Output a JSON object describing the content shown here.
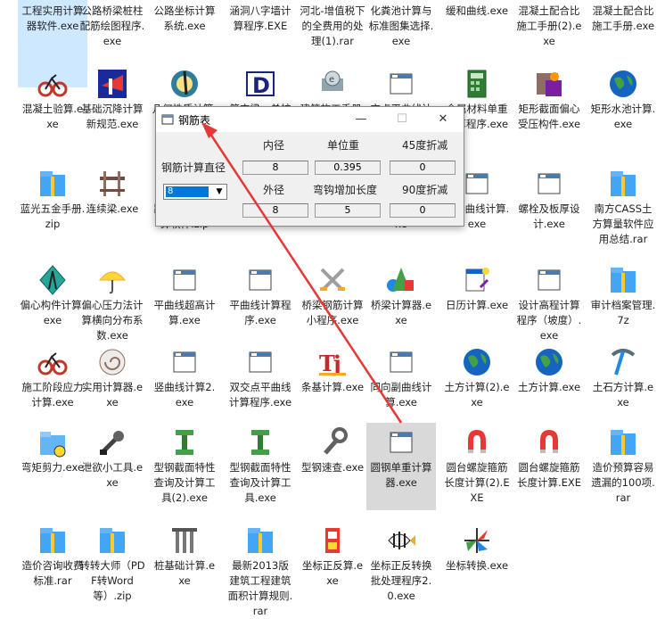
{
  "desktop": {
    "icons": [
      {
        "label": "工程实用计算器软件.exe",
        "art": "none"
      },
      {
        "label": "公路桥梁桩柱配筋绘图程序.exe",
        "art": "none"
      },
      {
        "label": "公路坐标计算系统.exe",
        "art": "none"
      },
      {
        "label": "涵洞八字墙计算程序.EXE",
        "art": "none"
      },
      {
        "label": "河北-增值税下的全费用的处理(1).rar",
        "art": "none"
      },
      {
        "label": "化粪池计算与标准图集选择.exe",
        "art": "none"
      },
      {
        "label": "缓和曲线.exe",
        "art": "none"
      },
      {
        "label": "混凝土配合比施工手册(2).exe",
        "art": "none"
      },
      {
        "label": "混凝土配合比施工手册.exe",
        "art": "none"
      },
      {
        "label": "混凝土验算.exe",
        "art": "bike"
      },
      {
        "label": "基础沉降计算新规范.exe",
        "art": "flag"
      },
      {
        "label": "几何性质计算.exe",
        "art": "compass"
      },
      {
        "label": "简支梁、单桩计算.exe",
        "art": "drafter"
      },
      {
        "label": "建筑施工手册.exe",
        "art": "printer"
      },
      {
        "label": "交点平曲线计算.exe",
        "art": "window"
      },
      {
        "label": "金属材料单重计算程序.exe",
        "art": "calc"
      },
      {
        "label": "矩形截面偏心受压构件.exe",
        "art": "installer"
      },
      {
        "label": "矩形水池计算.exe",
        "art": "globe"
      },
      {
        "label": "蓝光五金手册.zip",
        "art": "zip"
      },
      {
        "label": "连续梁.exe",
        "art": "bridge"
      },
      {
        "label": "路基土石方计算软件.zip",
        "art": "zip"
      },
      {
        "label": "",
        "art": "none"
      },
      {
        "label": "",
        "art": "none"
      },
      {
        "label": "平曲线计算.exe",
        "art": "window"
      },
      {
        "label": "弯形曲线计算.exe",
        "art": "window"
      },
      {
        "label": "螺栓及板厚设计.exe",
        "art": "window"
      },
      {
        "label": "南方CASS土方算量软件应用总结.rar",
        "art": "zip"
      },
      {
        "label": "偏心构件计算.exe",
        "art": "compasstool"
      },
      {
        "label": "偏心压力法计算横向分布系数.exe",
        "art": "umbrella"
      },
      {
        "label": "平曲线超高计算.exe",
        "art": "window"
      },
      {
        "label": "平曲线计算程序.exe",
        "art": "window"
      },
      {
        "label": "桥梁钢筋计算小程序.exe",
        "art": "swords"
      },
      {
        "label": "桥梁计算器.exe",
        "art": "shapes"
      },
      {
        "label": "日历计算.exe",
        "art": "calendar"
      },
      {
        "label": "设计高程计算程序（坡度）.exe",
        "art": "window"
      },
      {
        "label": "审计档案管理.7z",
        "art": "zip"
      },
      {
        "label": "施工阶段应力计算.exe",
        "art": "bike"
      },
      {
        "label": "实用计算器.exe",
        "art": "shell"
      },
      {
        "label": "竖曲线计算2.exe",
        "art": "window"
      },
      {
        "label": "双交点平曲线计算程序.exe",
        "art": "window"
      },
      {
        "label": "条基计算.exe",
        "art": "tj"
      },
      {
        "label": "同向副曲线计算.exe",
        "art": "window"
      },
      {
        "label": "土方计算(2).exe",
        "art": "globe"
      },
      {
        "label": "土方计算.exe",
        "art": "globe"
      },
      {
        "label": "土石方计算.exe",
        "art": "pick"
      },
      {
        "label": "弯矩剪力.exe",
        "art": "folderbadge"
      },
      {
        "label": "泄欲小工具.exe",
        "art": "tool"
      },
      {
        "label": "型钢截面特性查询及计算工具(2).exe",
        "art": "ibeam"
      },
      {
        "label": "型钢截面特性查询及计算工具.exe",
        "art": "ibeam"
      },
      {
        "label": "型钢速查.exe",
        "art": "wrench"
      },
      {
        "label": "圆钢单重计算器.exe",
        "art": "window"
      },
      {
        "label": "圆台螺旋箍筋长度计算(2).EXE",
        "art": "magnet"
      },
      {
        "label": "圆台螺旋箍筋长度计算.EXE",
        "art": "magnet"
      },
      {
        "label": "造价预算容易遗漏的100项.rar",
        "art": "zip"
      },
      {
        "label": "造价咨询收费标准.rar",
        "art": "zip"
      },
      {
        "label": "转转大师（PDF转Word等）.zip",
        "art": "zip"
      },
      {
        "label": "桩基础计算.exe",
        "art": "pillars"
      },
      {
        "label": "最新2013版建筑工程建筑面积计算规则.rar",
        "art": "zip"
      },
      {
        "label": "坐标正反算.exe",
        "art": "robot"
      },
      {
        "label": "坐标正反转换批处理程序2.0.exe",
        "art": "fish"
      },
      {
        "label": "坐标转换.exe",
        "art": "axes"
      }
    ]
  },
  "dialog": {
    "title": "钢筋表",
    "minimize": "—",
    "maximize": "☐",
    "close": "✕",
    "label_dia_calc": "钢筋计算直径",
    "label_inner": "内径",
    "label_unit_weight": "单位重",
    "label_45": "45度折减",
    "label_outer": "外径",
    "label_hook": "弯钩增加长度",
    "label_90": "90度折减",
    "val_inner": "8",
    "val_unit_weight": "0.395",
    "val_45": "0",
    "val_outer": "8",
    "val_hook": "5",
    "val_90": "0",
    "combo_value": "8"
  },
  "colors": {
    "accent": "#0078d7",
    "arrow": "#e53935"
  }
}
